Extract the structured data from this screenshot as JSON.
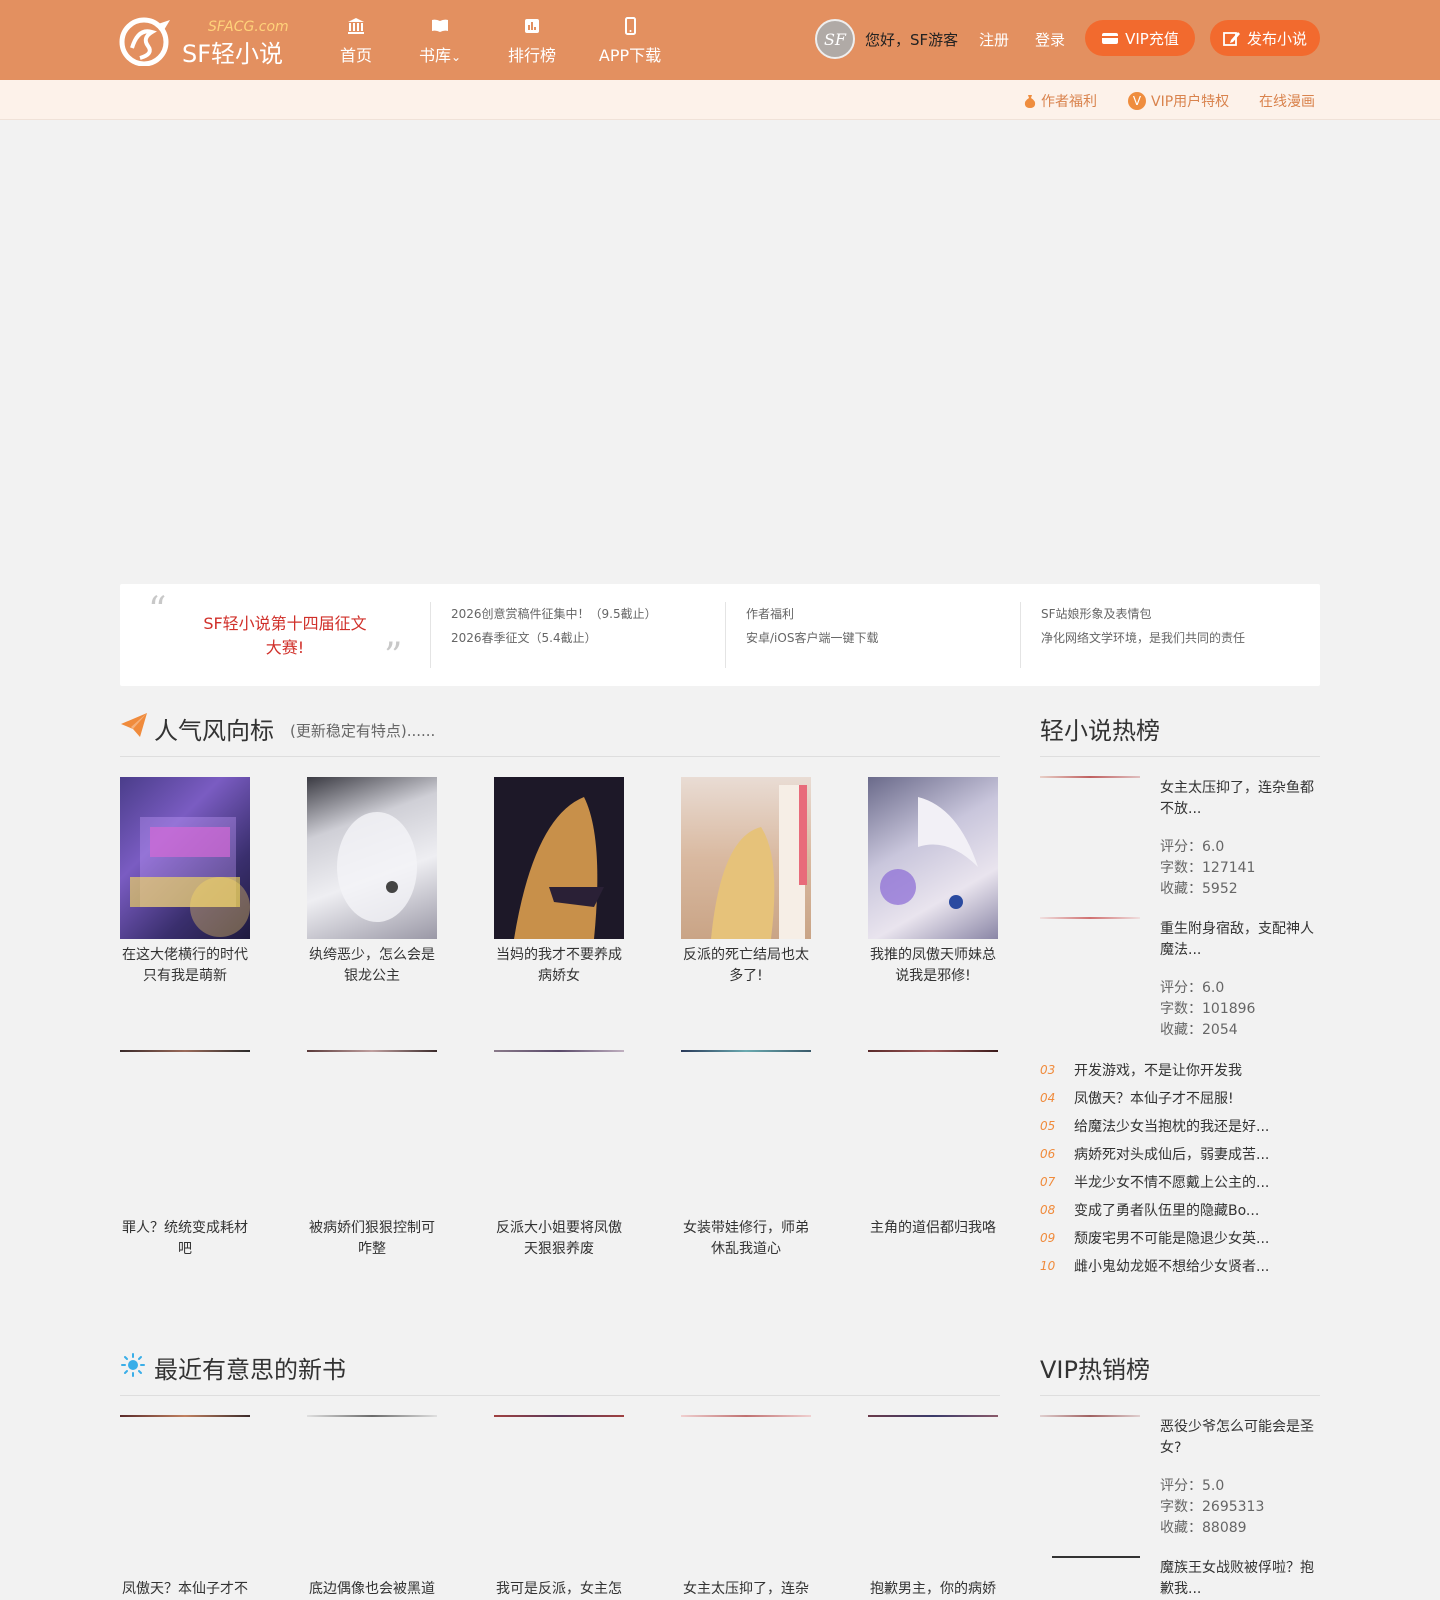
{
  "header": {
    "logo_sub": "SFACG.com",
    "logo_title": "SF轻小说",
    "nav": [
      {
        "label": "首页",
        "icon": "library-icon"
      },
      {
        "label": "书库",
        "icon": "book-icon",
        "chevron": "⌄"
      },
      {
        "label": "排行榜",
        "icon": "chart-icon"
      },
      {
        "label": "APP下载",
        "icon": "phone-icon"
      }
    ],
    "greeting": "您好，SF游客",
    "register": "注册",
    "login": "登录",
    "vip_recharge": "VIP充值",
    "publish": "发布小说",
    "accent": "#e39060",
    "button_color": "#f26a2e"
  },
  "subbar": {
    "links": [
      "作者福利",
      "VIP用户特权",
      "在线漫画"
    ],
    "vip_badge": "V"
  },
  "announce": {
    "contest": "SF轻小说第十四届征文大赛!",
    "columns": [
      {
        "line1": "2026创意赏稿件征集中！（9.5截止）",
        "line2": "2026春季征文（5.4截止）"
      },
      {
        "line1": "作者福利",
        "line2": "安卓/iOS客户端一键下载"
      },
      {
        "line1": "SF站娘形象及表情包",
        "line2": "净化网络文学环境，是我们共同的责任"
      }
    ]
  },
  "popular": {
    "title": "人气风向标",
    "subtitle": "(更新稳定有特点)......",
    "row1": [
      {
        "title": "在这大佬横行的时代只有我是萌新"
      },
      {
        "title": "纨绔恶少，怎么会是银龙公主"
      },
      {
        "title": "当妈的我才不要养成病娇女"
      },
      {
        "title": "反派的死亡结局也太多了!"
      },
      {
        "title": "我推的凤傲天师妹总说我是邪修!"
      }
    ],
    "row2": [
      {
        "title": "罪人？统统变成耗材吧"
      },
      {
        "title": "被病娇们狠狠控制可咋整"
      },
      {
        "title": "反派大小姐要将凤傲天狠狠养废"
      },
      {
        "title": "女装带娃修行，师弟休乱我道心"
      },
      {
        "title": "主角的道侣都归我咯"
      }
    ]
  },
  "hot": {
    "title": "轻小说热榜",
    "features": [
      {
        "title": "女主太压抑了，连杂鱼都不放...",
        "rating": "评分：6.0",
        "words": "字数：127141",
        "favs": "收藏：5952"
      },
      {
        "title": "重生附身宿敌，支配神人魔法...",
        "rating": "评分：6.0",
        "words": "字数：101896",
        "favs": "收藏：2054"
      }
    ],
    "list": [
      {
        "num": "03",
        "title": "开发游戏，不是让你开发我"
      },
      {
        "num": "04",
        "title": "凤傲天？本仙子才不屈服!"
      },
      {
        "num": "05",
        "title": "给魔法少女当抱枕的我还是好..."
      },
      {
        "num": "06",
        "title": "病娇死对头成仙后，弱妻成苦..."
      },
      {
        "num": "07",
        "title": "半龙少女不情不愿戴上公主的..."
      },
      {
        "num": "08",
        "title": "变成了勇者队伍里的隐藏Bo..."
      },
      {
        "num": "09",
        "title": "颓废宅男不可能是隐退少女英..."
      },
      {
        "num": "10",
        "title": "雌小鬼幼龙姬不想给少女贤者..."
      }
    ]
  },
  "newbooks": {
    "title": "最近有意思的新书",
    "items": [
      {
        "title": "凤傲天？本仙子才不"
      },
      {
        "title": "底边偶像也会被黑道"
      },
      {
        "title": "我可是反派，女主怎"
      },
      {
        "title": "女主太压抑了，连杂"
      },
      {
        "title": "抱歉男主，你的病娇"
      }
    ]
  },
  "vip": {
    "title": "VIP热销榜",
    "features": [
      {
        "title": "恶役少爷怎么可能会是圣女?",
        "rating": "评分：5.0",
        "words": "字数：2695313",
        "favs": "收藏：88089"
      },
      {
        "title": "魔族王女战败被俘啦？抱歉我..."
      }
    ]
  }
}
